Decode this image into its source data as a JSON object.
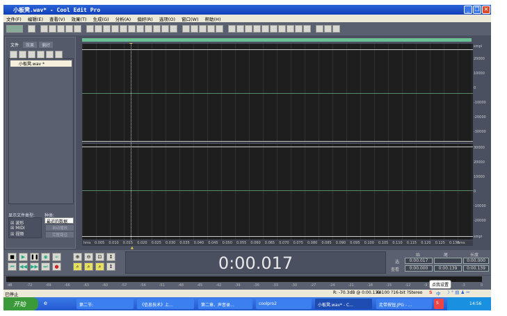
{
  "window": {
    "title": "小板凳.wav* - Cool Edit Pro",
    "min": "_",
    "restore": "❐",
    "close": "✕"
  },
  "menu": [
    "文件(F)",
    "编辑(E)",
    "查看(V)",
    "效果(T)",
    "生成(G)",
    "分析(A)",
    "偏好(R)",
    "选项(O)",
    "窗口(W)",
    "帮助(H)"
  ],
  "left": {
    "tabs": [
      "文件",
      "效果",
      "偏好"
    ],
    "file": "小板凳.wav *",
    "show_types_label": "显示文件类型:",
    "types": [
      "波形",
      "MIDI",
      "视频"
    ],
    "kind_label": "种类:",
    "kind_value": "最近的数据",
    "buttons": [
      "自动播放",
      "完整路径"
    ]
  },
  "axis": {
    "unit": "smpl",
    "ch1": [
      "20000",
      "10000",
      "0",
      "-10000",
      "-20000",
      "-30000"
    ],
    "ch2": [
      "30000",
      "20000",
      "10000",
      "0",
      "-10000",
      "-20000"
    ],
    "bottom_unit": "smpl"
  },
  "ruler": {
    "unit": "hms",
    "ticks": [
      "0.005",
      "0.010",
      "0.015",
      "0.020",
      "0.025",
      "0.030",
      "0.035",
      "0.040",
      "0.045",
      "0.050",
      "0.055",
      "0.060",
      "0.065",
      "0.070",
      "0.075",
      "0.080",
      "0.085",
      "0.090",
      "0.095",
      "0.100",
      "0.105",
      "0.110",
      "0.115",
      "0.120",
      "0.125",
      "0.130"
    ]
  },
  "time_display": "0:00.017",
  "selection": {
    "headers": [
      "始",
      "尾",
      "长度"
    ],
    "rows": [
      {
        "label": "选",
        "values": [
          "0:00.017",
          "",
          "0:00.000"
        ]
      },
      {
        "label": "查看",
        "values": [
          "0:00.000",
          "0:00.139",
          "0:00.139"
        ]
      }
    ]
  },
  "meter": {
    "ticks": [
      "dB",
      "-72",
      "-69",
      "-66",
      "-63",
      "-60",
      "-57",
      "-54",
      "-51",
      "-48",
      "-45",
      "-42",
      "-39",
      "-36",
      "-33",
      "-30",
      "-27",
      "-24",
      "-21",
      "-18",
      "-15",
      "-12",
      "-9",
      "-6",
      "-3",
      "0"
    ]
  },
  "status": {
    "state": "已停止",
    "level": "R: -70.3dB @  0:00.131",
    "format": "44100 ?16-bit ?Stereo",
    "tooltip": "点我设置"
  },
  "taskbar": {
    "start": "开始",
    "items": [
      "第二节:",
      "《信息技术》上...",
      "第二章、声音录...",
      "coolpro2",
      "小板凳.wav* - C...",
      "走带按钮.JPG - ..."
    ],
    "clock": "14:56",
    "ime": "中"
  },
  "colors": {
    "titlebar": "#2a62d8",
    "waveform_bg": "#1e1e1e",
    "overview_bar": "#6cc096",
    "centerline": "#5a8a6a"
  }
}
